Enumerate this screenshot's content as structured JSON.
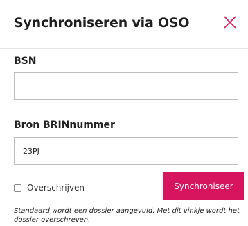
{
  "dialog": {
    "title": "Synchroniseren via OSO",
    "close_icon": "close-icon",
    "accent_color": "#d6155e"
  },
  "form": {
    "bsn": {
      "label": "BSN",
      "value": "",
      "placeholder": ""
    },
    "brin": {
      "label": "Bron BRINnummer",
      "value": "23PJ",
      "placeholder": ""
    },
    "overwrite": {
      "label": "Overschrijven",
      "checked": false
    },
    "submit_label": "Synchroniseer",
    "help_text": "Standaard wordt een dossier aangevuld. Met dit vinkje wordt het dossier overschreven."
  }
}
